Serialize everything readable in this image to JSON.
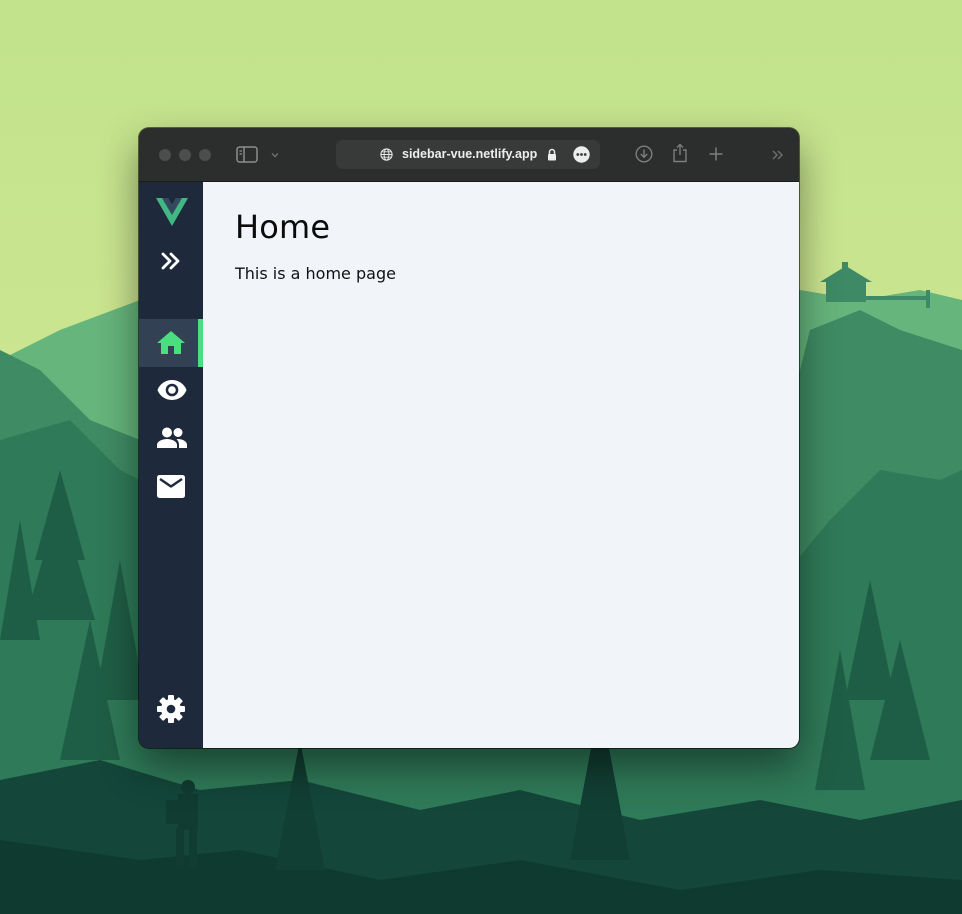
{
  "browser": {
    "url": "sidebar-vue.netlify.app"
  },
  "sidebar": {
    "logo_icon": "vue-logo-icon",
    "toggle_icon": "double-chevron-right-icon",
    "active_accent_color": "#4ade80",
    "background_color": "#1e293b",
    "items": [
      {
        "icon": "home-icon",
        "active": true
      },
      {
        "icon": "eye-icon",
        "active": false
      },
      {
        "icon": "people-icon",
        "active": false
      },
      {
        "icon": "mail-icon",
        "active": false
      }
    ],
    "settings_icon": "gear-icon"
  },
  "main": {
    "title": "Home",
    "text": "This is a home page",
    "background_color": "#f1f5f9"
  }
}
